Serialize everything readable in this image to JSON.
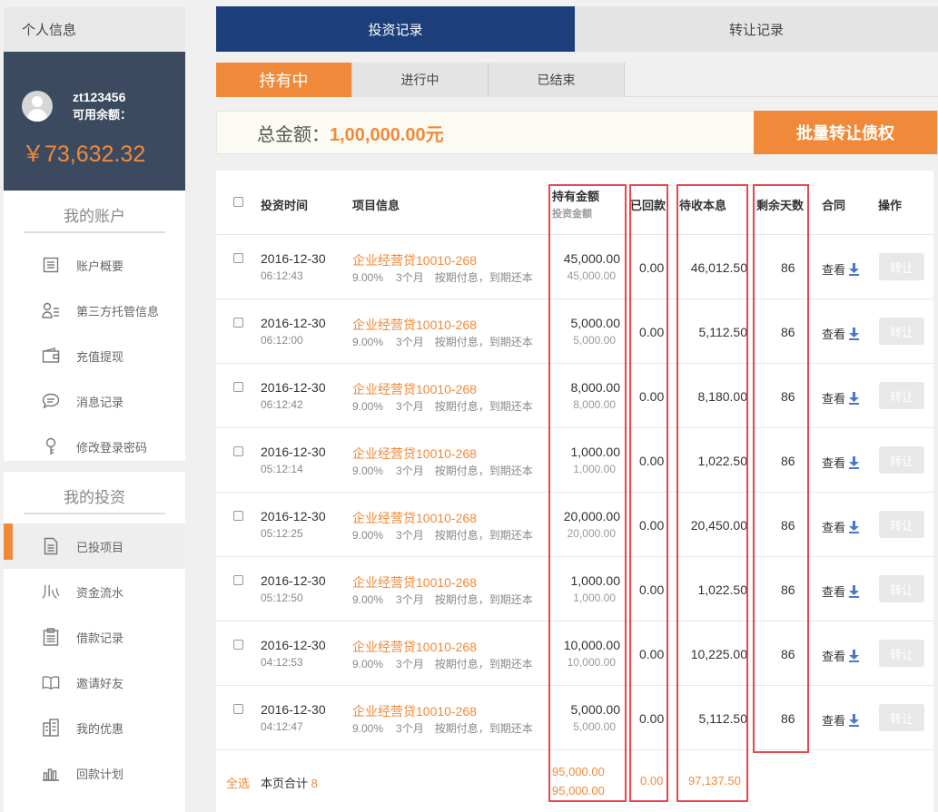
{
  "sidebar": {
    "header": "个人信息",
    "user": {
      "name": "zt123456",
      "balance_label": "可用余额：",
      "balance": "￥73,632.32"
    },
    "account": {
      "title": "我的账户",
      "items": [
        {
          "label": "账户概要",
          "icon": "list-icon"
        },
        {
          "label": "第三方托管信息",
          "icon": "user-list-icon"
        },
        {
          "label": "充值提现",
          "icon": "wallet-icon"
        },
        {
          "label": "消息记录",
          "icon": "chat-icon"
        },
        {
          "label": "修改登录密码",
          "icon": "key-icon"
        }
      ]
    },
    "investment": {
      "title": "我的投资",
      "items": [
        {
          "label": "已投项目",
          "icon": "document-icon",
          "active": true
        },
        {
          "label": "资金流水",
          "icon": "flow-icon"
        },
        {
          "label": "借款记录",
          "icon": "clipboard-icon"
        },
        {
          "label": "邀请好友",
          "icon": "book-icon"
        },
        {
          "label": "我的优惠",
          "icon": "building-icon"
        },
        {
          "label": "回款计划",
          "icon": "bar-chart-icon"
        }
      ]
    }
  },
  "tabs": {
    "invest_record": "投资记录",
    "transfer_record": "转让记录"
  },
  "subtabs": {
    "holding": "持有中",
    "in_progress": "进行中",
    "ended": "已结束"
  },
  "summary": {
    "label": "总金额：",
    "value": "1,00,000.00元",
    "batch_button": "批量转让债权"
  },
  "table": {
    "headers": {
      "time": "投资时间",
      "project": "项目信息",
      "holding": "持有金额",
      "holding_sub": "投资金额",
      "repaid": "已回款",
      "pending": "待收本息",
      "days_left": "剩余天数",
      "contract": "合同",
      "action": "操作"
    },
    "rows": [
      {
        "date": "2016-12-30",
        "time": "06:12:43",
        "project": "企业经营贷10010-268",
        "rate": "9.00%",
        "term": "3个月",
        "method": "按期付息，到期还本",
        "holding": "45,000.00",
        "invested": "45,000.00",
        "repaid": "0.00",
        "pending": "46,012.50",
        "days": "86",
        "view": "查看",
        "transfer": "转让"
      },
      {
        "date": "2016-12-30",
        "time": "06:12:00",
        "project": "企业经营贷10010-268",
        "rate": "9.00%",
        "term": "3个月",
        "method": "按期付息，到期还本",
        "holding": "5,000.00",
        "invested": "5,000.00",
        "repaid": "0.00",
        "pending": "5,112.50",
        "days": "86",
        "view": "查看",
        "transfer": "转让"
      },
      {
        "date": "2016-12-30",
        "time": "06:12:42",
        "project": "企业经营贷10010-268",
        "rate": "9.00%",
        "term": "3个月",
        "method": "按期付息，到期还本",
        "holding": "8,000.00",
        "invested": "8,000.00",
        "repaid": "0.00",
        "pending": "8,180.00",
        "days": "86",
        "view": "查看",
        "transfer": "转让"
      },
      {
        "date": "2016-12-30",
        "time": "05:12:14",
        "project": "企业经营贷10010-268",
        "rate": "9.00%",
        "term": "3个月",
        "method": "按期付息，到期还本",
        "holding": "1,000.00",
        "invested": "1,000.00",
        "repaid": "0.00",
        "pending": "1,022.50",
        "days": "86",
        "view": "查看",
        "transfer": "转让"
      },
      {
        "date": "2016-12-30",
        "time": "05:12:25",
        "project": "企业经营贷10010-268",
        "rate": "9.00%",
        "term": "3个月",
        "method": "按期付息，到期还本",
        "holding": "20,000.00",
        "invested": "20,000.00",
        "repaid": "0.00",
        "pending": "20,450.00",
        "days": "86",
        "view": "查看",
        "transfer": "转让"
      },
      {
        "date": "2016-12-30",
        "time": "05:12:50",
        "project": "企业经营贷10010-268",
        "rate": "9.00%",
        "term": "3个月",
        "method": "按期付息，到期还本",
        "holding": "1,000.00",
        "invested": "1,000.00",
        "repaid": "0.00",
        "pending": "1,022.50",
        "days": "86",
        "view": "查看",
        "transfer": "转让"
      },
      {
        "date": "2016-12-30",
        "time": "04:12:53",
        "project": "企业经营贷10010-268",
        "rate": "9.00%",
        "term": "3个月",
        "method": "按期付息，到期还本",
        "holding": "10,000.00",
        "invested": "10,000.00",
        "repaid": "0.00",
        "pending": "10,225.00",
        "days": "86",
        "view": "查看",
        "transfer": "转让"
      },
      {
        "date": "2016-12-30",
        "time": "04:12:47",
        "project": "企业经营贷10010-268",
        "rate": "9.00%",
        "term": "3个月",
        "method": "按期付息，到期还本",
        "holding": "5,000.00",
        "invested": "5,000.00",
        "repaid": "0.00",
        "pending": "5,112.50",
        "days": "86",
        "view": "查看",
        "transfer": "转让"
      }
    ],
    "footer": {
      "select_all": "全选",
      "page_total_label": "本页合计",
      "page_total_count": "8",
      "holding_total": "95,000.00",
      "invested_total": "95,000.00",
      "repaid_total": "0.00",
      "pending_total": "97,137.50"
    }
  },
  "colors": {
    "accent": "#f08a3a",
    "navy": "#1c3f7c",
    "sidebar_dark": "#3c4a5f",
    "highlight_box": "#e8474f"
  }
}
